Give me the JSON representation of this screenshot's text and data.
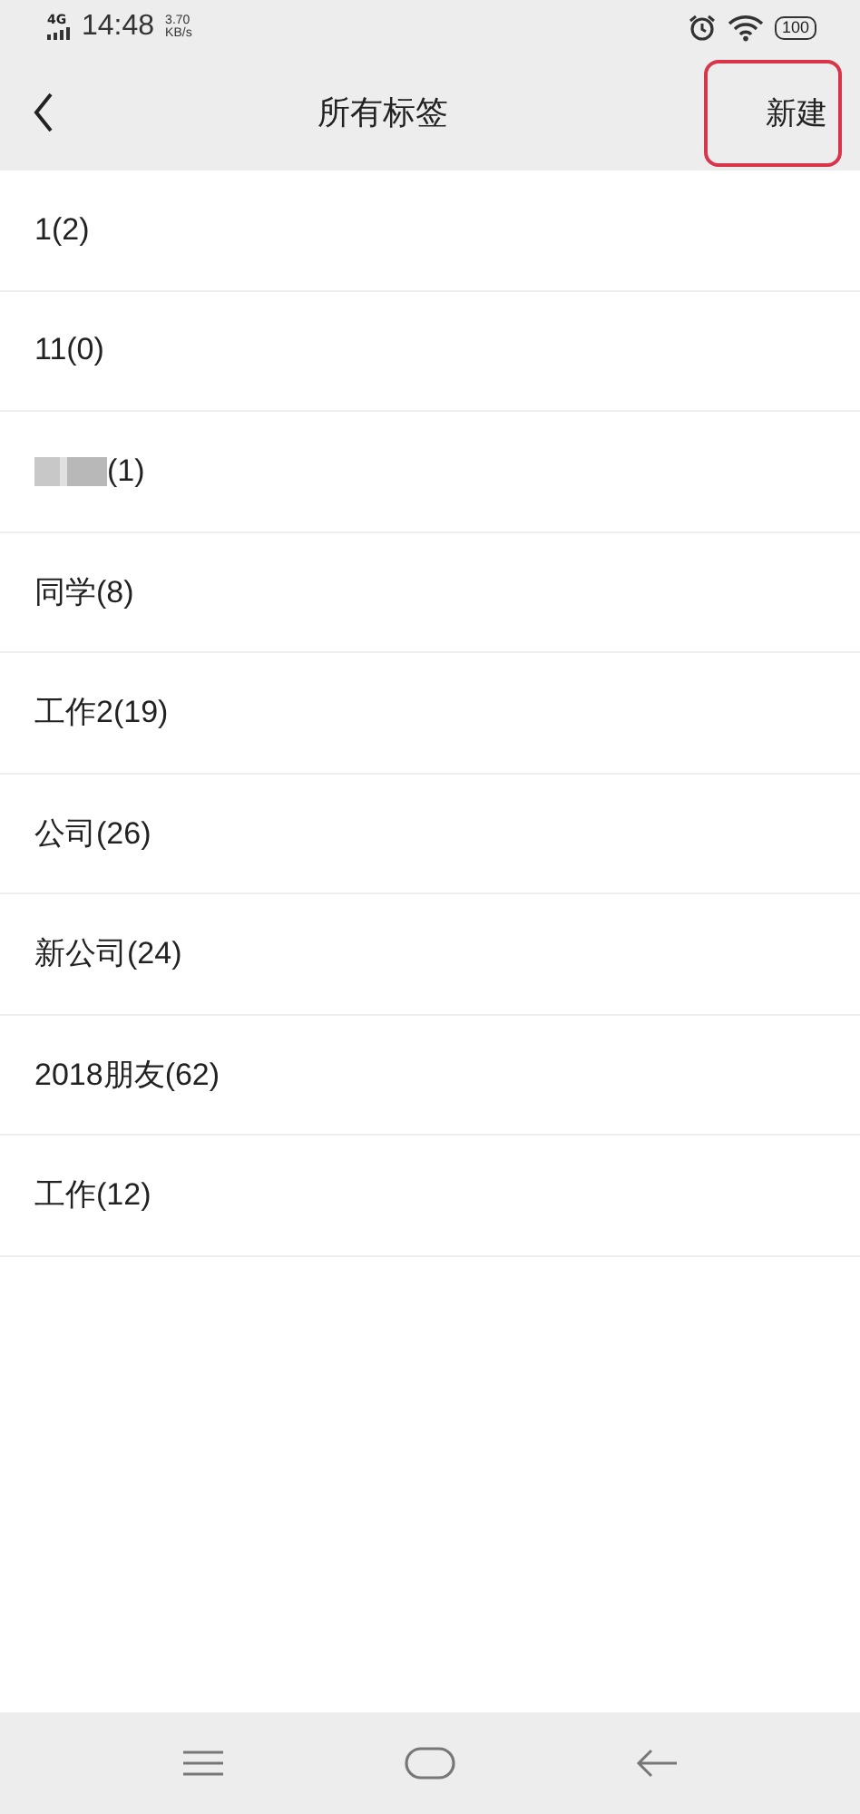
{
  "status_bar": {
    "network": "4G",
    "time": "14:48",
    "speed_value": "3.70",
    "speed_unit": "KB/s",
    "battery": "100"
  },
  "header": {
    "title": "所有标签",
    "action": {
      "label": "新建",
      "highlighted": true
    }
  },
  "tags": [
    {
      "label": "1(2)",
      "blurred": false
    },
    {
      "label": "11(0)",
      "blurred": false
    },
    {
      "label": "(1)",
      "blurred": true
    },
    {
      "label": "同学(8)",
      "blurred": false
    },
    {
      "label": "工作2(19)",
      "blurred": false
    },
    {
      "label": "公司(26)",
      "blurred": false
    },
    {
      "label": "新公司(24)",
      "blurred": false
    },
    {
      "label": "2018朋友(62)",
      "blurred": false
    },
    {
      "label": "工作(12)",
      "blurred": false
    }
  ]
}
